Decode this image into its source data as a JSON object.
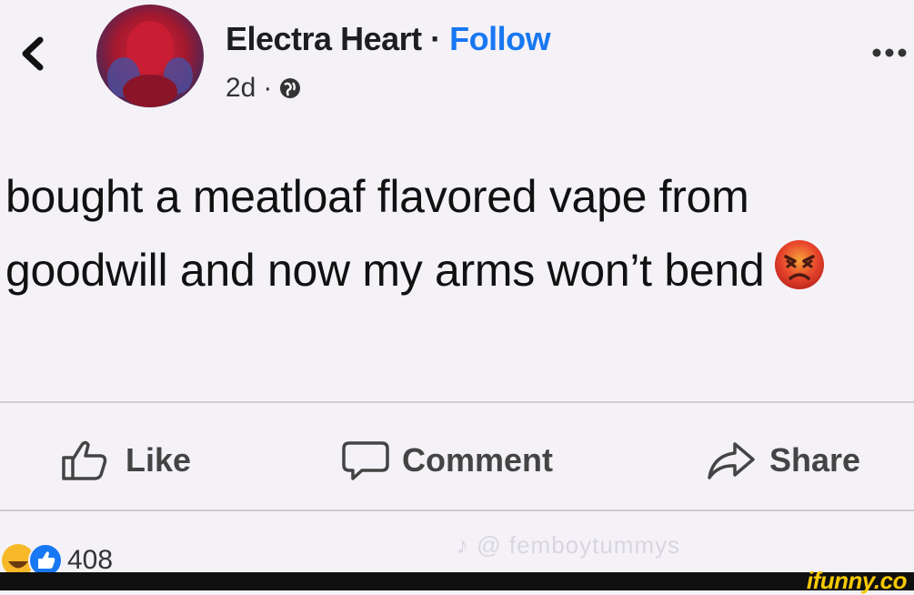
{
  "header": {
    "author_name": "Electra Heart",
    "separator": "·",
    "follow_label": "Follow",
    "timestamp": "2d",
    "meta_separator": "·"
  },
  "post": {
    "text": "bought a meatloaf flavored vape from goodwill and now my arms won’t bend"
  },
  "actions": {
    "like_label": "Like",
    "comment_label": "Comment",
    "share_label": "Share"
  },
  "reactions": {
    "count": "408"
  },
  "watermark": {
    "text": "femboytummys"
  },
  "brand": {
    "logo_text": "ifunny.co"
  },
  "colors": {
    "accent": "#1877f2",
    "background": "#f4f2f7",
    "brand": "#f6c900"
  }
}
